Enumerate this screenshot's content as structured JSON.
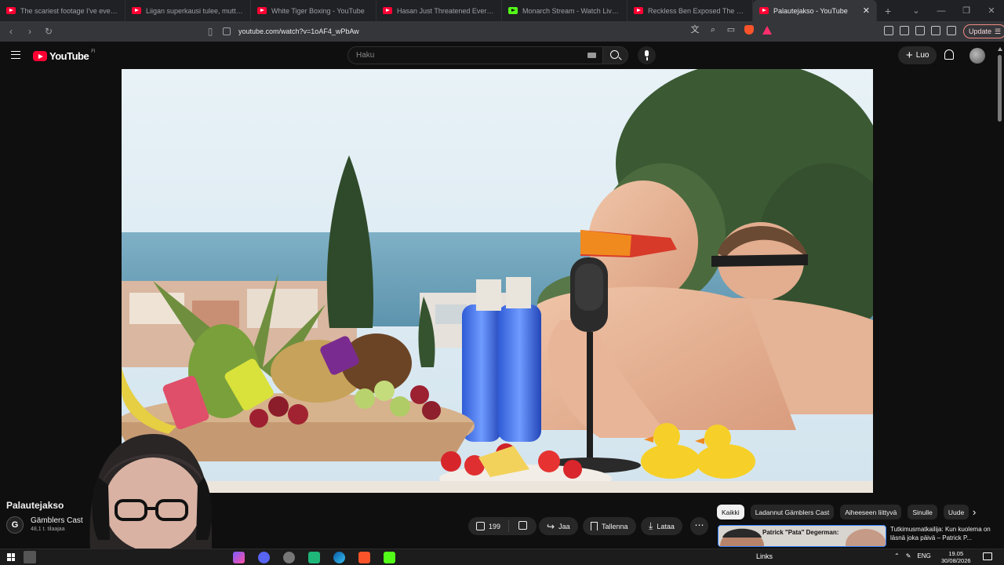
{
  "browser": {
    "tabs": [
      {
        "label": "The scariest footage I've ever seen...",
        "kind": "youtube"
      },
      {
        "label": "Liigan superkausi tulee, mutta studi",
        "kind": "youtube"
      },
      {
        "label": "White Tiger Boxing - YouTube",
        "kind": "youtube"
      },
      {
        "label": "Hasan Just Threatened Everyone Big",
        "kind": "youtube"
      },
      {
        "label": "Monarch Stream - Watch Live o",
        "kind": "kick"
      },
      {
        "label": "Reckless Ben Exposed The Most Evil",
        "kind": "youtube"
      },
      {
        "label": "Palautejakso - YouTube",
        "kind": "youtube",
        "active": true
      }
    ],
    "url": "youtube.com/watch?v=1oAF4_wPbAw",
    "update_label": "Update",
    "new_tab_icon": "plus-icon"
  },
  "youtube": {
    "logo_text": "YouTube",
    "country_code": "FI",
    "search_placeholder": "Haku",
    "create_label": "Luo",
    "video": {
      "title": "Palautejakso",
      "channel_initial": "G",
      "channel_name": "Gämblers Cast",
      "subscribers": "48,1 t. tilaajaa",
      "likes": "199",
      "share_label": "Jaa",
      "save_label": "Tallenna",
      "download_label": "Lataa"
    },
    "chips": [
      {
        "label": "Kaikki",
        "active": true
      },
      {
        "label": "Ladannut Gämblers Cast"
      },
      {
        "label": "Aiheeseen liittyvä"
      },
      {
        "label": "Sinulle"
      },
      {
        "label": "Uude"
      }
    ],
    "recommendation": {
      "thumb_text": "Patrick \"Pata\" Degerman:",
      "title": "Tutkimusmatkailija: Kun kuolema on läsnä joka päivä – Patrick P..."
    }
  },
  "taskbar": {
    "links_label": "Links",
    "lang": "ENG",
    "time": "19.05",
    "date": "30/08/2026"
  },
  "colors": {
    "youtube_red": "#ff0033",
    "background": "#0f0f0f",
    "chip_active": "#f1f1f1"
  }
}
